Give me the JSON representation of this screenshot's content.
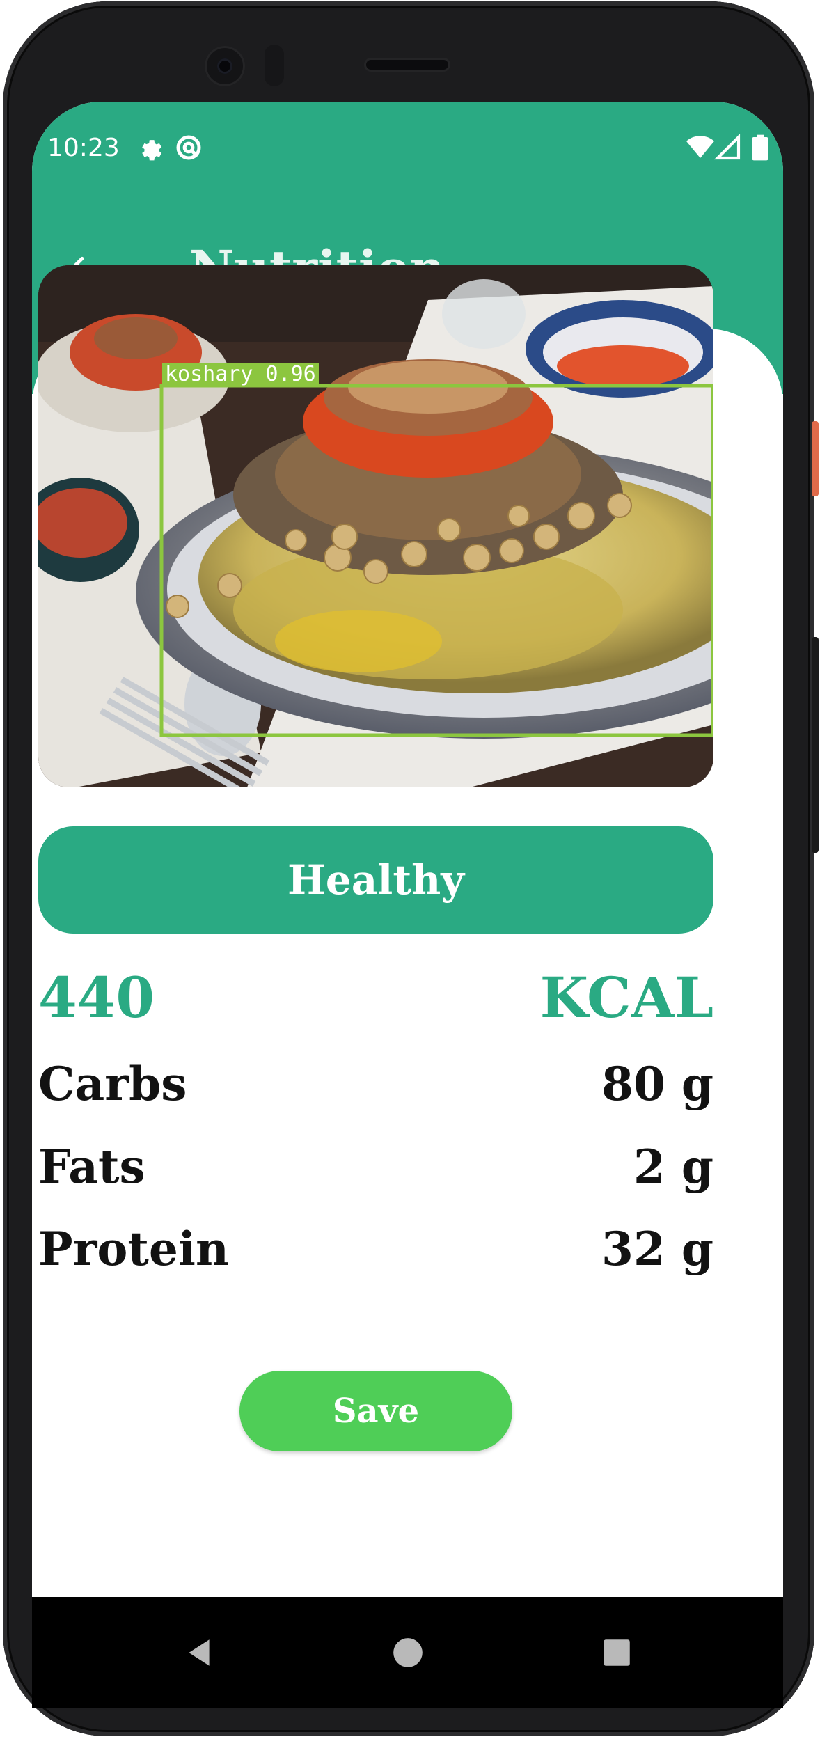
{
  "status_bar": {
    "time": "10:23",
    "icons": [
      "gear-icon",
      "sync-icon",
      "wifi-icon",
      "signal-icon",
      "battery-icon"
    ]
  },
  "toolbar": {
    "title": "Nutrition",
    "back_icon": "arrow-left-icon"
  },
  "food_image": {
    "detection_label": "koshary 0.96",
    "detection_color": "#8cc63f"
  },
  "status_button": {
    "label": "Healthy"
  },
  "nutrition": {
    "calories": {
      "value": "440",
      "unit": "KCAL"
    },
    "rows": [
      {
        "label": "Carbs",
        "value": "80 g"
      },
      {
        "label": "Fats",
        "value": "2 g"
      },
      {
        "label": "Protein",
        "value": "32 g"
      }
    ]
  },
  "save_button": {
    "label": "Save"
  },
  "nav_bar": {
    "buttons": [
      "back-triangle-icon",
      "home-circle-icon",
      "recents-square-icon"
    ]
  },
  "colors": {
    "primary": "#2aaa83",
    "save": "#4fce57",
    "text": "#121212",
    "nav": "#000000"
  }
}
